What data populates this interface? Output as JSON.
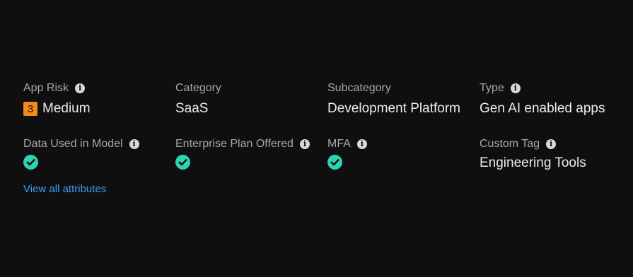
{
  "colors": {
    "background": "#0f0f10",
    "risk_medium": "#f28a1c",
    "check": "#2dd4b0",
    "link": "#3d9cf0"
  },
  "attributes": {
    "app_risk": {
      "label": "App Risk",
      "score": "3",
      "level": "Medium",
      "icon": "info-icon"
    },
    "category": {
      "label": "Category",
      "value": "SaaS"
    },
    "subcategory": {
      "label": "Subcategory",
      "value": "Development Platform"
    },
    "type": {
      "label": "Type",
      "value": "Gen AI enabled apps",
      "icon": "info-icon"
    },
    "data_used_in_model": {
      "label": "Data Used in Model",
      "icon": "info-icon",
      "status_icon": "check-circle-icon"
    },
    "enterprise_plan_offered": {
      "label": "Enterprise Plan Offered",
      "icon": "info-icon",
      "status_icon": "check-circle-icon"
    },
    "mfa": {
      "label": "MFA",
      "icon": "info-icon",
      "status_icon": "check-circle-icon"
    },
    "custom_tag": {
      "label": "Custom Tag",
      "value": "Engineering Tools",
      "icon": "info-icon"
    }
  },
  "view_all_link": "View all attributes"
}
